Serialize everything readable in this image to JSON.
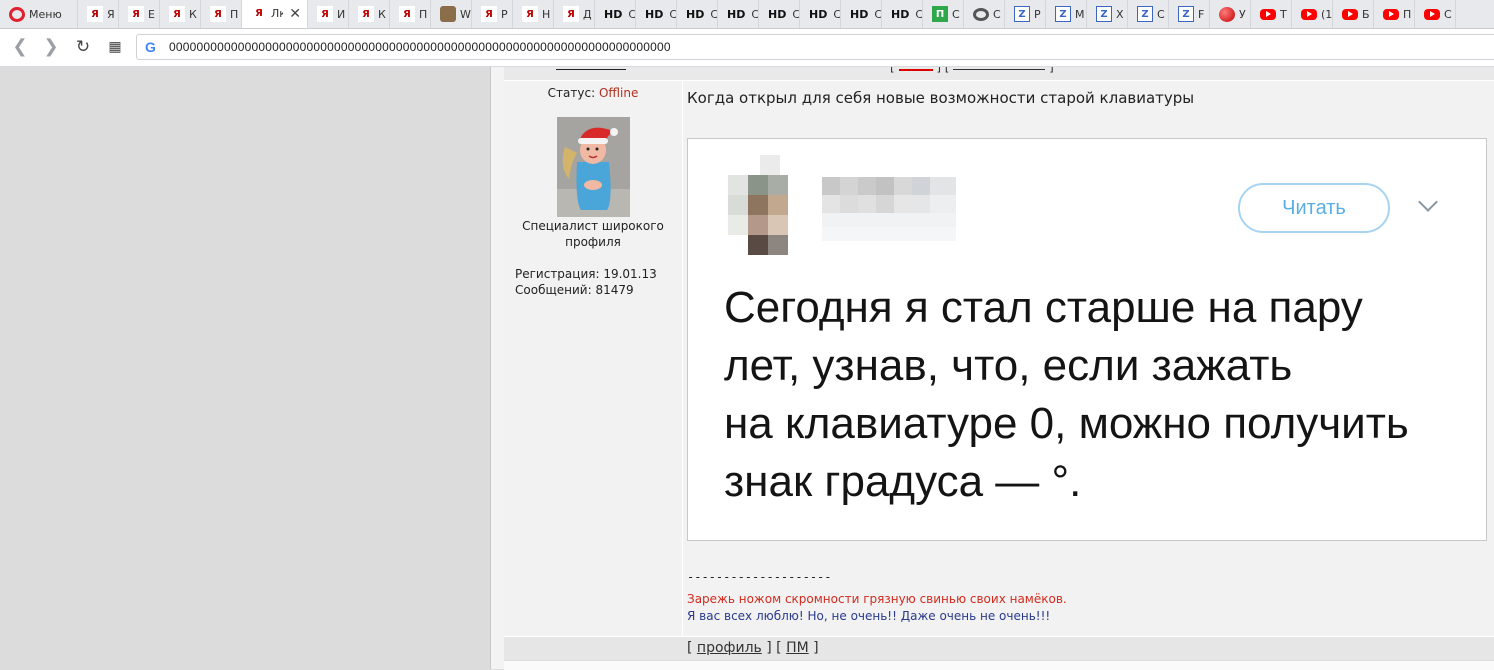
{
  "browser": {
    "menu_label": "Меню",
    "tabs": [
      {
        "icon": "opera-logo-icon",
        "title": "Меню",
        "w": 0
      },
      {
        "icon": "yaplakal-icon",
        "title": "Я"
      },
      {
        "icon": "yaplakal-icon",
        "title": "Е"
      },
      {
        "icon": "yaplakal-icon",
        "title": "К"
      },
      {
        "icon": "yaplakal-icon",
        "title": "П"
      },
      {
        "icon": "yaplakal-icon",
        "title": "Лк",
        "active": true
      },
      {
        "icon": "yaplakal-icon",
        "title": "И"
      },
      {
        "icon": "yaplakal-icon",
        "title": "К"
      },
      {
        "icon": "yaplakal-icon",
        "title": "П"
      },
      {
        "icon": "avatar-icon",
        "title": "W"
      },
      {
        "icon": "yaplakal-icon",
        "title": "Р"
      },
      {
        "icon": "yaplakal-icon",
        "title": "Н"
      },
      {
        "icon": "yaplakal-icon",
        "title": "Д"
      },
      {
        "icon": "hd-icon",
        "title": "С"
      },
      {
        "icon": "hd-icon",
        "title": "С"
      },
      {
        "icon": "hd-icon",
        "title": "С"
      },
      {
        "icon": "hd-icon",
        "title": "С"
      },
      {
        "icon": "hd-icon",
        "title": "С"
      },
      {
        "icon": "hd-icon",
        "title": "С"
      },
      {
        "icon": "hd-icon",
        "title": "С"
      },
      {
        "icon": "hd-icon",
        "title": "С"
      },
      {
        "icon": "green-icon",
        "title": "С"
      },
      {
        "icon": "gear-icon",
        "title": "С"
      },
      {
        "icon": "z-icon",
        "title": "Р"
      },
      {
        "icon": "z-icon",
        "title": "М"
      },
      {
        "icon": "z-icon",
        "title": "Х"
      },
      {
        "icon": "z-icon",
        "title": "С"
      },
      {
        "icon": "z-icon",
        "title": "F"
      },
      {
        "icon": "red-ball-icon",
        "title": "У"
      },
      {
        "icon": "youtube-icon",
        "title": "Т"
      },
      {
        "icon": "youtube-icon",
        "title": "(1"
      },
      {
        "icon": "youtube-icon",
        "title": "Б"
      },
      {
        "icon": "youtube-icon",
        "title": "П"
      },
      {
        "icon": "youtube-icon",
        "title": "С"
      }
    ],
    "address": {
      "url": "0000000000000000000000000000000000000000000000000000000000000000000000000"
    }
  },
  "post": {
    "author_panel": {
      "status_label": "Статус:",
      "status_value": "Offline",
      "rank": "Специалист широкого профиля",
      "registration": "Регистрация: 19.01.13",
      "messages": "Сообщений: 81479"
    },
    "text": "Когда открыл для себя новые возможности старой клавиатуры",
    "meme": {
      "button_label": "Читать",
      "lines": [
        "Сегодня я стал старше на пару",
        "лет, узнав, что, если зажать",
        "на клавиатуре 0, можно получить",
        "знак градуса — °."
      ]
    },
    "signature": {
      "divider": "--------------------",
      "line1": "Зарежь ножом скромности грязную свинью своих намёков.",
      "line2": "Я вас всех люблю! Но, не очень!! Даже очень не очень!!!"
    },
    "footer_links": {
      "open1": "[",
      "profile": "профиль",
      "mid": "] [",
      "pm": "ПМ",
      "close": "]"
    }
  },
  "colors": {
    "offline": "#b03020",
    "sig_red": "#d42b1e",
    "sig_blue": "#2a3a8c",
    "read_button": "#5aaee6"
  }
}
